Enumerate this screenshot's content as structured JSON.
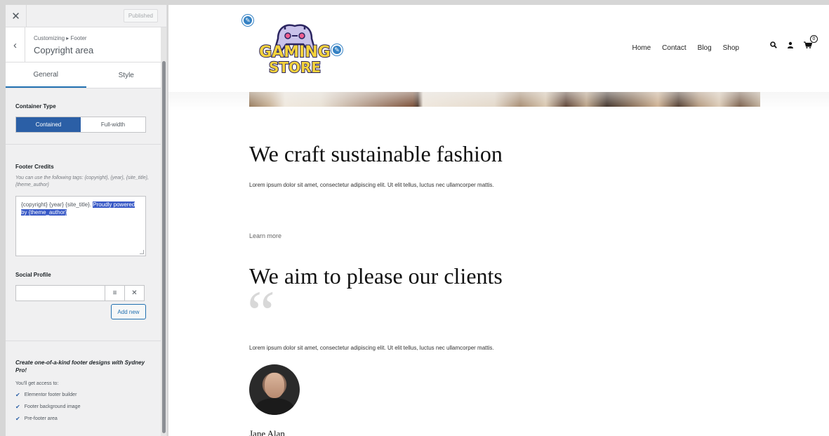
{
  "sidebar": {
    "published_label": "Published",
    "breadcrumb": "Customizing ▸ Footer",
    "title": "Copyright area",
    "tabs": [
      {
        "label": "General",
        "active": true
      },
      {
        "label": "Style",
        "active": false
      }
    ],
    "container_type": {
      "label": "Container Type",
      "options": [
        "Contained",
        "Full-width"
      ],
      "selected": "Contained"
    },
    "footer_credits": {
      "label": "Footer Credits",
      "help": "You can use the following tags: {copyright}, {year}, {site_title}, {theme_author}",
      "value_plain": "{copyright} {year} {site_title}. ",
      "value_selected": "Proudly powered by {theme_author}"
    },
    "social_profile": {
      "label": "Social Profile",
      "input_value": "",
      "add_new_label": "Add new"
    },
    "promo": {
      "title": "Create one-of-a-kind footer designs with Sydney Pro!",
      "subtitle": "You'll get access to:",
      "items": [
        "Elementor footer builder",
        "Footer background image",
        "Pre-footer area"
      ]
    }
  },
  "preview": {
    "logo_text_top": "GAMING",
    "logo_text_bottom": "STORE",
    "nav": [
      "Home",
      "Contact",
      "Blog",
      "Shop"
    ],
    "cart_count": "0",
    "section1": {
      "heading": "We craft sustainable fashion",
      "body": "Lorem ipsum dolor sit amet, consectetur adipiscing elit. Ut elit tellus, luctus nec ullamcorper mattis.",
      "link": "Learn more"
    },
    "section2": {
      "heading": "We aim to please our clients",
      "body": "Lorem ipsum dolor sit amet, consectetur adipiscing elit. Ut elit tellus, luctus nec ullamcorper mattis.",
      "person_name": "Jane Alan"
    }
  },
  "colors": {
    "accent": "#2b5fa6",
    "selection": "#3758c6",
    "edit_pencil": "#3582c4"
  }
}
